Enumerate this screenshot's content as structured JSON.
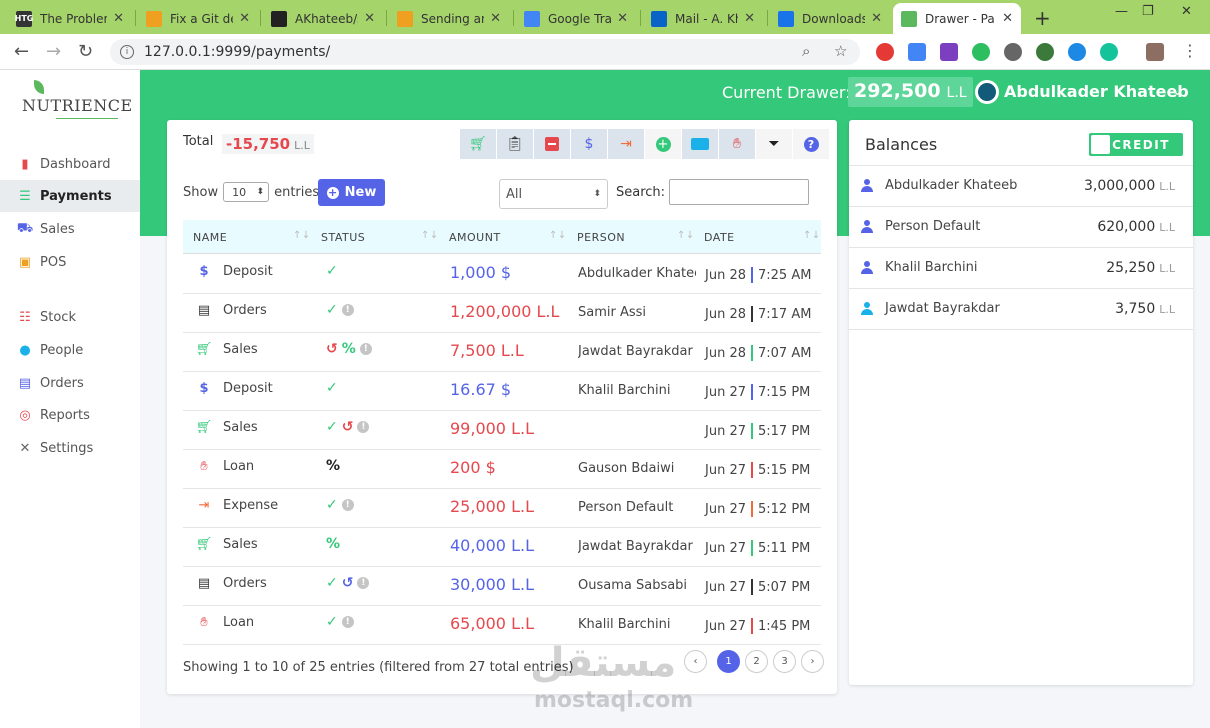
{
  "browser": {
    "tabs": [
      {
        "label": "The Problem",
        "favicon": "HTG",
        "color": "#333333"
      },
      {
        "label": "Fix a Git det",
        "favicon": "",
        "color": "#f0a020"
      },
      {
        "label": "AKhateeb/s",
        "favicon": "",
        "color": "#222222"
      },
      {
        "label": "Sending an",
        "favicon": "",
        "color": "#f0a020"
      },
      {
        "label": "Google Tran",
        "favicon": "",
        "color": "#4285f4"
      },
      {
        "label": "Mail - A. Kh",
        "favicon": "",
        "color": "#0a64c8"
      },
      {
        "label": "Downloads",
        "favicon": "",
        "color": "#1a73e8"
      },
      {
        "label": "Drawer - Pa",
        "favicon": "",
        "color": "#5cb85c"
      }
    ],
    "url": "127.0.0.1:9999/payments/"
  },
  "sidebar": {
    "brand": "NUTRIENCE",
    "items": [
      {
        "label": "Dashboard",
        "icon": "bar-chart-icon",
        "color": "#e5484d"
      },
      {
        "label": "Payments",
        "icon": "list-icon",
        "color": "#34c87a"
      },
      {
        "label": "Sales",
        "icon": "basket-icon",
        "color": "#5564e6"
      },
      {
        "label": "POS",
        "icon": "pos-icon",
        "color": "#f0a020"
      },
      {
        "label": "Stock",
        "icon": "stack-icon",
        "color": "#e5484d"
      },
      {
        "label": "People",
        "icon": "user-circle-icon",
        "color": "#1ab0e8"
      },
      {
        "label": "Orders",
        "icon": "orders-icon",
        "color": "#5564e6"
      },
      {
        "label": "Reports",
        "icon": "compass-icon",
        "color": "#e5484d"
      },
      {
        "label": "Settings",
        "icon": "wrench-icon",
        "color": "#666666"
      }
    ]
  },
  "header": {
    "drawer_label": "Current Drawer:",
    "drawer_value": "292,500",
    "drawer_currency": "L.L",
    "user_name": "Abdulkader Khateeb"
  },
  "payments": {
    "total_label": "Total",
    "total_value": "-15,750",
    "total_currency": "L.L",
    "show_label": "Show",
    "page_length": "10",
    "entries_label": "entries",
    "new_label": "New",
    "filter_value": "All",
    "search_label": "Search:",
    "search_value": "",
    "columns": [
      "NAME",
      "STATUS",
      "AMOUNT",
      "PERSON",
      "DATE"
    ],
    "rows": [
      {
        "name": "Deposit",
        "icon": "dollar-coin-icon",
        "icon_color": "#5564e6",
        "status": [
          "check"
        ],
        "amount": "1,000 $",
        "amount_color": "blue",
        "person": "Abdulkader Khateeb",
        "date": "Jun 28",
        "time": "7:25 AM",
        "bar_color": "#5564e6"
      },
      {
        "name": "Orders",
        "icon": "clipboard-icon",
        "icon_color": "#333333",
        "status": [
          "check",
          "info"
        ],
        "amount": "1,200,000 L.L",
        "amount_color": "red",
        "person": "Samir Assi",
        "date": "Jun 28",
        "time": "7:17 AM",
        "bar_color": "#333333"
      },
      {
        "name": "Sales",
        "icon": "cart-icon",
        "icon_color": "#34c87a",
        "status": [
          "undo",
          "percent",
          "info"
        ],
        "amount": "7,500 L.L",
        "amount_color": "red",
        "person": "Jawdat Bayrakdar",
        "date": "Jun 28",
        "time": "7:07 AM",
        "bar_color": "#34c87a"
      },
      {
        "name": "Deposit",
        "icon": "dollar-coin-icon",
        "icon_color": "#5564e6",
        "status": [
          "check"
        ],
        "amount": "16.67 $",
        "amount_color": "blue",
        "person": "Khalil Barchini",
        "date": "Jun 27",
        "time": "7:15 PM",
        "bar_color": "#5564e6"
      },
      {
        "name": "Sales",
        "icon": "cart-icon",
        "icon_color": "#34c87a",
        "status": [
          "check",
          "undo",
          "info"
        ],
        "amount": "99,000 L.L",
        "amount_color": "red",
        "person": "",
        "date": "Jun 27",
        "time": "5:17 PM",
        "bar_color": "#34c87a"
      },
      {
        "name": "Loan",
        "icon": "hand-dollar-icon",
        "icon_color": "#e5484d",
        "status": [
          "percent-dark"
        ],
        "amount": "200 $",
        "amount_color": "red",
        "person": "Gauson Bdaiwi",
        "date": "Jun 27",
        "time": "5:15 PM",
        "bar_color": "#e5484d"
      },
      {
        "name": "Expense",
        "icon": "sign-out-icon",
        "icon_color": "#f26b3a",
        "status": [
          "check",
          "info"
        ],
        "amount": "25,000 L.L",
        "amount_color": "red",
        "person": "Person Default",
        "date": "Jun 27",
        "time": "5:12 PM",
        "bar_color": "#f26b3a"
      },
      {
        "name": "Sales",
        "icon": "cart-icon",
        "icon_color": "#34c87a",
        "status": [
          "percent"
        ],
        "amount": "40,000 L.L",
        "amount_color": "blue",
        "person": "Jawdat Bayrakdar",
        "date": "Jun 27",
        "time": "5:11 PM",
        "bar_color": "#34c87a"
      },
      {
        "name": "Orders",
        "icon": "clipboard-icon",
        "icon_color": "#333333",
        "status": [
          "check",
          "undo-blue",
          "info"
        ],
        "amount": "30,000 L.L",
        "amount_color": "blue",
        "person": "Ousama Sabsabi",
        "date": "Jun 27",
        "time": "5:07 PM",
        "bar_color": "#333333"
      },
      {
        "name": "Loan",
        "icon": "hand-dollar-icon",
        "icon_color": "#e5484d",
        "status": [
          "check",
          "info"
        ],
        "amount": "65,000 L.L",
        "amount_color": "red",
        "person": "Khalil Barchini",
        "date": "Jun 27",
        "time": "1:45 PM",
        "bar_color": "#e5484d"
      }
    ],
    "footer_text": "Showing 1 to 10 of 25 entries (filtered from 27 total entries)",
    "pages": [
      "1",
      "2",
      "3"
    ],
    "current_page": "1"
  },
  "balances": {
    "title": "Balances",
    "toggle_label": "CREDIT",
    "items": [
      {
        "name": "Abdulkader Khateeb",
        "amount": "3,000,000",
        "currency": "L.L",
        "icon_color": "#5564e6"
      },
      {
        "name": "Person Default",
        "amount": "620,000",
        "currency": "L.L",
        "icon_color": "#5564e6"
      },
      {
        "name": "Khalil Barchini",
        "amount": "25,250",
        "currency": "L.L",
        "icon_color": "#5564e6"
      },
      {
        "name": "Jawdat Bayrakdar",
        "amount": "3,750",
        "currency": "L.L",
        "icon_color": "#1ab0e8"
      }
    ]
  },
  "watermark": {
    "arabic": "مستقل",
    "latin": "mostaql.com"
  },
  "colors": {
    "brand_green": "#34c87a",
    "primary": "#5564e6",
    "danger": "#e5484d"
  }
}
